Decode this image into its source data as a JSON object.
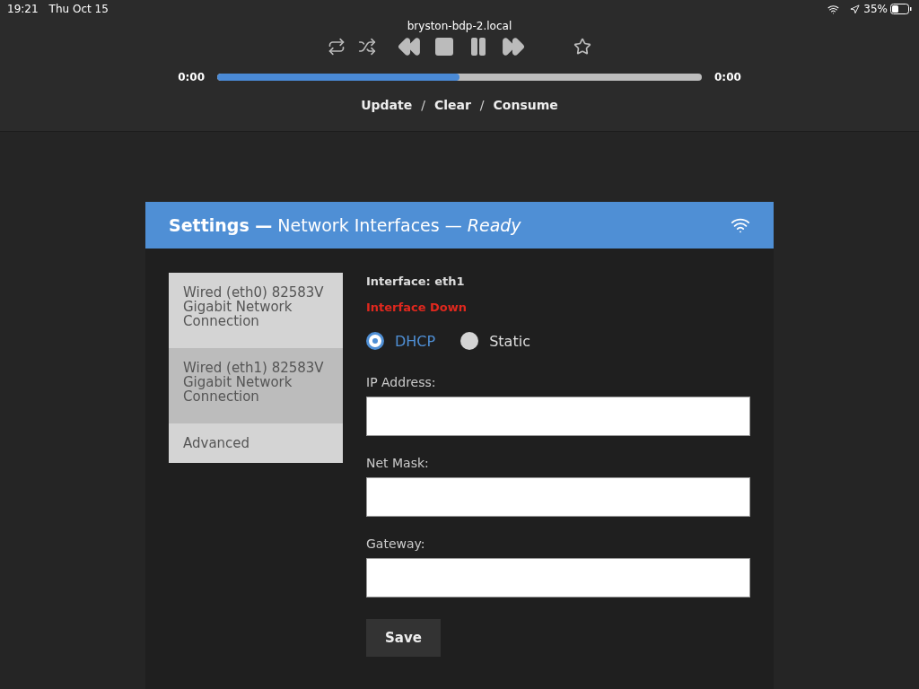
{
  "status_bar": {
    "time": "19:21",
    "date": "Thu Oct 15",
    "battery": "35%"
  },
  "player": {
    "host": "bryston-bdp-2.local",
    "elapsed": "0:00",
    "duration": "0:00",
    "level": 0.5,
    "actions": [
      {
        "kind": "action",
        "label": "Update"
      },
      {
        "kind": "separator",
        "label": "/"
      },
      {
        "kind": "action",
        "label": "Clear"
      },
      {
        "kind": "separator",
        "label": "/"
      },
      {
        "kind": "action",
        "label": "Consume"
      }
    ]
  },
  "panel": {
    "title": "**Settings —** Network Interfaces — *Ready*",
    "sidebar": {
      "items": [
        {
          "label": "Wired (eth0) 82583V Gigabit Network Connection",
          "selected": false
        },
        {
          "label": "Wired (eth1) 82583V Gigabit Network Connection",
          "selected": true
        },
        {
          "label": "Advanced",
          "selected": false
        }
      ]
    },
    "interface": "Interface: eth1",
    "status": "Interface Down",
    "modes": [
      {
        "label": "DHCP",
        "selected": true
      },
      {
        "label": "Static",
        "selected": false
      }
    ],
    "fields": [
      {
        "label": "IP Address:"
      },
      {
        "label": "Net Mask:"
      },
      {
        "label": "Gateway:"
      }
    ],
    "save": "Save"
  }
}
